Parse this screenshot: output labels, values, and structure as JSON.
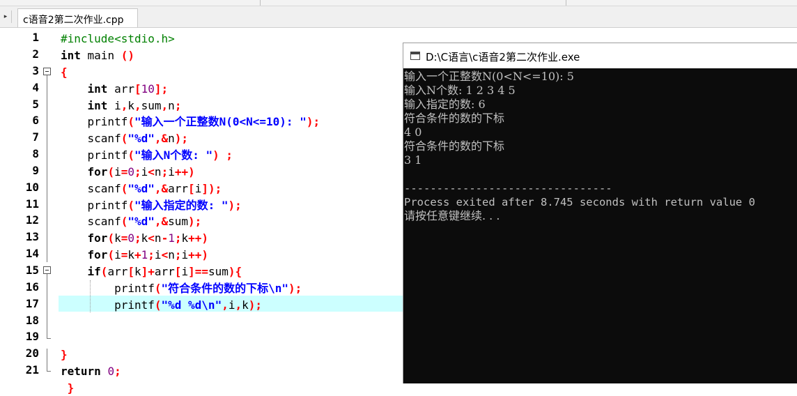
{
  "tab": {
    "filename": "c语音2第二次作业.cpp"
  },
  "gutter": {
    "line_numbers": [
      "1",
      "2",
      "3",
      "4",
      "5",
      "6",
      "7",
      "8",
      "9",
      "10",
      "11",
      "12",
      "13",
      "14",
      "15",
      "16",
      "17",
      "18",
      "19",
      "20",
      "21"
    ]
  },
  "code": {
    "l1": {
      "a": "#include<stdio.h>"
    },
    "l2": {
      "a": "int",
      "b": " main ",
      "c": "()"
    },
    "l3": {
      "a": "{"
    },
    "l4": {
      "a": "    ",
      "b": "int",
      "c": " arr",
      "d": "[",
      "e": "10",
      "f": "];"
    },
    "l5": {
      "a": "    ",
      "b": "int",
      "c": " i",
      "d": ",",
      "e": "k",
      "f": ",",
      "g": "sum",
      "h": ",",
      "i": "n",
      "j": ";"
    },
    "l6": {
      "a": "    printf",
      "b": "(",
      "c": "\"输入一个正整数N(0<N<=10): \"",
      "d": ");"
    },
    "l7": {
      "a": "    scanf",
      "b": "(",
      "c": "\"%d\"",
      "d": ",&",
      "e": "n",
      "f": ");"
    },
    "l8": {
      "a": "    printf",
      "b": "(",
      "c": "\"输入N个数: \"",
      "d": ") ;"
    },
    "l9": {
      "a": "    ",
      "b": "for",
      "c": "(",
      "d": "i",
      "e": "=",
      "f": "0",
      "g": ";",
      "h": "i",
      "i": "<",
      "j": "n",
      "k": ";",
      "l": "i",
      "m": "++)"
    },
    "l10": {
      "a": "    scanf",
      "b": "(",
      "c": "\"%d\"",
      "d": ",&",
      "e": "arr",
      "f": "[",
      "g": "i",
      "h": "]);"
    },
    "l11": {
      "a": "    printf",
      "b": "(",
      "c": "\"输入指定的数: \"",
      "d": ");"
    },
    "l12": {
      "a": "    scanf",
      "b": "(",
      "c": "\"%d\"",
      "d": ",&",
      "e": "sum",
      "f": ");"
    },
    "l13": {
      "a": "    ",
      "b": "for",
      "c": "(",
      "d": "k",
      "e": "=",
      "f": "0",
      "g": ";",
      "h": "k",
      "i": "<",
      "j": "n",
      "k": "-",
      "l": "1",
      "m": ";",
      "n": "k",
      "o": "++)"
    },
    "l14": {
      "a": "    ",
      "b": "for",
      "c": "(",
      "d": "i",
      "e": "=",
      "f": "k",
      "g": "+",
      "h": "1",
      "i": ";",
      "j": "i",
      "k": "<",
      "l": "n",
      "m": ";",
      "n": "i",
      "o": "++)"
    },
    "l15": {
      "a": "    ",
      "b": "if",
      "c": "(",
      "d": "arr",
      "e": "[",
      "f": "k",
      "g": "]+",
      "h": "arr",
      "i": "[",
      "j": "i",
      "k": "]==",
      "l": "sum",
      "m": "){"
    },
    "l16": {
      "a": "        printf",
      "b": "(",
      "c": "\"符合条件的数的下标\\n\"",
      "d": ");"
    },
    "l17": {
      "a": "        printf",
      "b": "(",
      "c": "\"%d %d\\n\"",
      "d": ",",
      "e": "i",
      "f": ",",
      "g": "k",
      "h": ");"
    },
    "l19": {
      "a": "}"
    },
    "l20": {
      "a": "return",
      "b": " ",
      "c": "0",
      "d": ";"
    },
    "l21": {
      "a": " }"
    }
  },
  "console": {
    "title": "D:\\C语言\\c语音2第二次作业.exe",
    "lines": [
      "输入一个正整数N(0<N<=10): 5",
      "输入N个数: 1 2 3 4 5",
      "输入指定的数: 6",
      "符合条件的数的下标",
      "4 0",
      "符合条件的数的下标",
      "3 1",
      "",
      "--------------------------------",
      "Process exited after 8.745 seconds with return value 0",
      "请按任意键继续. . ."
    ]
  }
}
